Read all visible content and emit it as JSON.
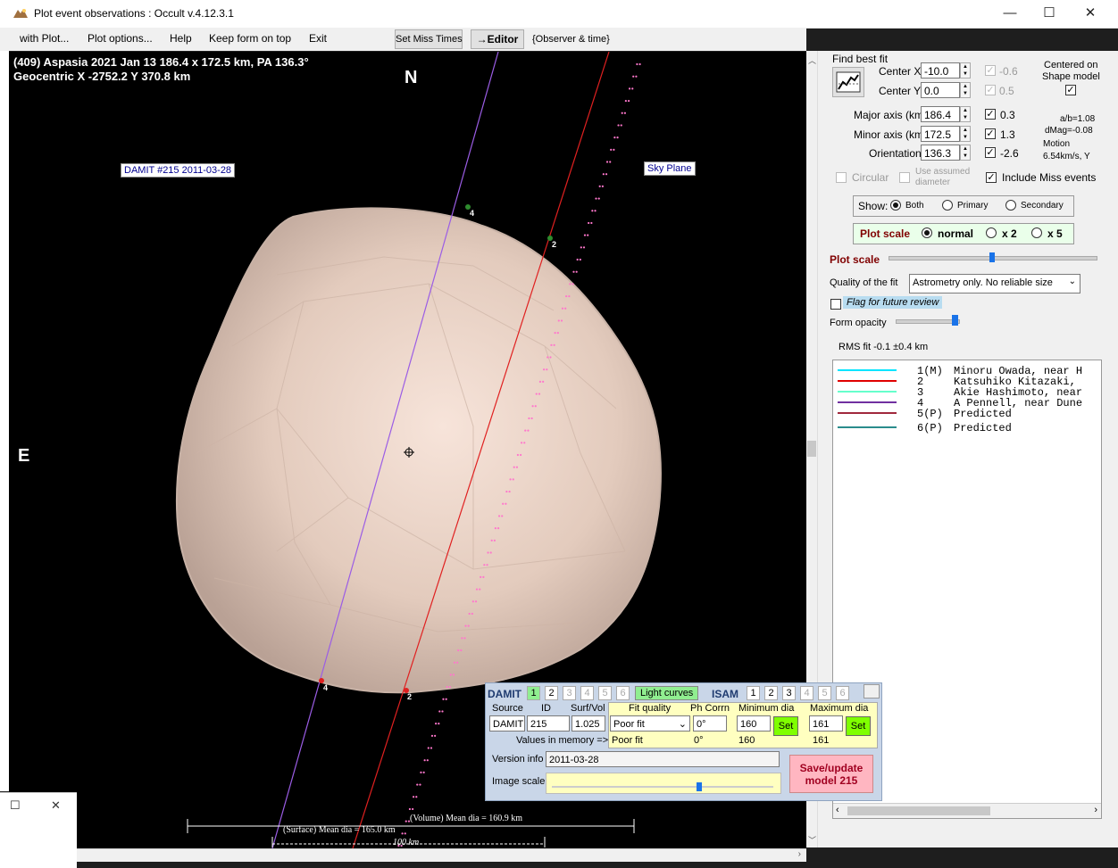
{
  "window": {
    "title": "Plot event observations : Occult v.4.12.3.1",
    "minimize": "—",
    "maximize": "☐",
    "close": "✕"
  },
  "menu": {
    "items": [
      "with Plot...",
      "Plot options...",
      "Help",
      "Keep form on top",
      "Exit"
    ],
    "set_miss_times": "Set Miss Times",
    "editor": "→Editor",
    "observer_time": "{Observer & time}"
  },
  "plot": {
    "header_line1": "(409) Aspasia  2021 Jan 13   186.4 x 172.5 km, PA 136.3°",
    "header_line2": "Geocentric  X  -2752.2  Y 370.8 km",
    "north": "N",
    "east": "E",
    "damit_label": "DAMIT #215 2011-03-28",
    "sky_plane": "Sky Plane",
    "chord_labels": [
      "4",
      "2",
      "4",
      "2"
    ],
    "volume_mean": "(Volume) Mean dia = 160.9 km",
    "surface_mean": "(Surface) Mean dia = 165.0 km",
    "scale_bar": "100 km",
    "colors": {
      "chord1": "#9b5de5",
      "chord2": "#e02020",
      "predicted": "#ff77cc"
    }
  },
  "fit": {
    "find_best_fit": "Find best fit",
    "center_x_label": "Center X",
    "center_x": "-10.0",
    "center_y_label": "Center Y",
    "center_y": "0.0",
    "major_label": "Major axis (km)",
    "major": "186.4",
    "minor_label": "Minor axis (km)",
    "minor": "172.5",
    "orient_label": "Orientation",
    "orient": "136.3",
    "cx_delta": "-0.6",
    "cy_delta": "0.5",
    "major_delta": "0.3",
    "minor_delta": "1.3",
    "orient_delta": "-2.6",
    "centered_on": "Centered on",
    "shape_model": "Shape model",
    "ab_ratio": "a/b=1.08",
    "dmag": "dMag=-0.08",
    "motion": "Motion",
    "motion_val": "6.54km/s, Y",
    "circular": "Circular",
    "use_assumed": "Use assumed",
    "diameter": "diameter",
    "include_miss": "Include Miss events"
  },
  "show": {
    "label": "Show:",
    "options": [
      "Both",
      "Primary",
      "Secondary"
    ],
    "selected": "Both"
  },
  "plot_scale": {
    "label": "Plot scale",
    "options": [
      "normal",
      "x 2",
      "x 5"
    ],
    "slider_label": "Plot scale",
    "slider_value": 0.5
  },
  "quality": {
    "label": "Quality of the fit",
    "value": "Astrometry only. No reliable size"
  },
  "flag_review": "Flag for future review",
  "form_opacity": {
    "label": "Form opacity",
    "value": 1.0
  },
  "rms": "RMS fit -0.1 ±0.4 km",
  "legend": [
    {
      "num": "1(M)",
      "text": "Minoru Owada, near H",
      "color": "#00e5ff"
    },
    {
      "num": "2",
      "text": "Katsuhiko Kitazaki,",
      "color": "#e00000"
    },
    {
      "num": "3",
      "text": "Akie Hashimoto, near",
      "color": "#66ffcc"
    },
    {
      "num": "4",
      "text": "A Pennell, near Dune",
      "color": "#7030a0"
    },
    {
      "num": "5(P)",
      "text": "Predicted",
      "color": "#a0283c"
    },
    {
      "num": "6(P)",
      "text": "Predicted",
      "color": "#2a8c8c"
    }
  ],
  "damit": {
    "title": "DAMIT",
    "tabs": [
      "1",
      "2",
      "3",
      "4",
      "5",
      "6"
    ],
    "light_curves": "Light curves",
    "isam": "ISAM",
    "isam_tabs": [
      "1",
      "2",
      "3",
      "4",
      "5",
      "6"
    ],
    "source_label": "Source",
    "id_label": "ID",
    "surfvol_label": "Surf/Vol",
    "source": "DAMIT",
    "id": "215",
    "surfvol": "1.025",
    "fit_quality_label": "Fit quality",
    "ph_corrn_label": "Ph Corrn",
    "min_dia_label": "Minimum dia",
    "max_dia_label": "Maximum dia",
    "fit_quality": "Poor fit",
    "ph_corrn": "0°",
    "min_dia": "160",
    "max_dia": "161",
    "set": "Set",
    "values_in_memory": "Values in memory =>",
    "mem_fit": "Poor fit",
    "mem_ph": "0°",
    "mem_min": "160",
    "mem_max": "161",
    "version_label": "Version info",
    "version": "2011-03-28",
    "image_scale": "Image scale",
    "image_scale_value": 0.67,
    "save": "Save/update\nmodel 215"
  },
  "small_window": {
    "restore": "☐",
    "close": "✕"
  }
}
